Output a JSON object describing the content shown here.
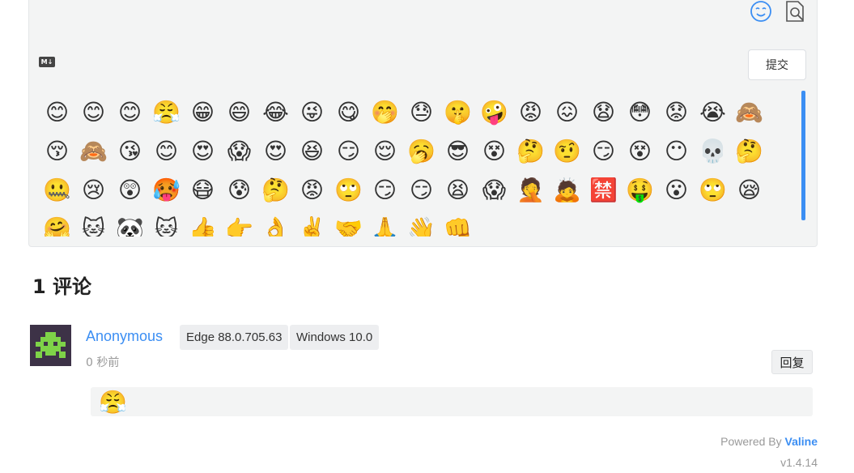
{
  "editor": {
    "md_label": "M↓",
    "submit_label": "提交",
    "icons": [
      "emoji-picker-icon",
      "preview-icon"
    ],
    "emojis": [
      "😊",
      "😊",
      "😊",
      "😤",
      "😁",
      "😄",
      "😂",
      "😜",
      "😋",
      "🤭",
      "😓",
      "🤫",
      "🤪",
      "😡",
      "😖",
      "😧",
      "😳",
      "😟",
      "😭",
      "🙈",
      "😚",
      "🙈",
      "😘",
      "😊",
      "😍",
      "😱",
      "😍",
      "😆",
      "😏",
      "😌",
      "🥱",
      "😎",
      "😵",
      "🤔",
      "🤨",
      "😏",
      "😵",
      "😶",
      "💀",
      "🤔",
      "🤐",
      "😢",
      "😲",
      "🥵",
      "😷",
      "😰",
      "🤔",
      "😡",
      "🙄",
      "😏",
      "😏",
      "😫",
      "😱",
      "🤦",
      "🙇",
      "🈲",
      "🤑",
      "😮",
      "🙄",
      "😪",
      "🤗",
      "🐱",
      "🐼",
      "🐱",
      "👍",
      "👉",
      "👌",
      "✌️",
      "🤝",
      "🙏",
      "👋",
      "👊"
    ]
  },
  "comments": {
    "count_title": "1 评论",
    "items": [
      {
        "nick": "Anonymous",
        "browser": "Edge 88.0.705.63",
        "os": "Windows 10.0",
        "time": "0 秒前",
        "reply_label": "回复",
        "content": "😤"
      }
    ]
  },
  "footer": {
    "powered_prefix": "Powered By ",
    "powered_link": "Valine",
    "version": "v1.4.14"
  },
  "colors": {
    "accent": "#3b8ef3",
    "panel_bg": "#f3f4f4",
    "avatar_bg": "#3d3247",
    "avatar_fg": "#7ed348"
  }
}
